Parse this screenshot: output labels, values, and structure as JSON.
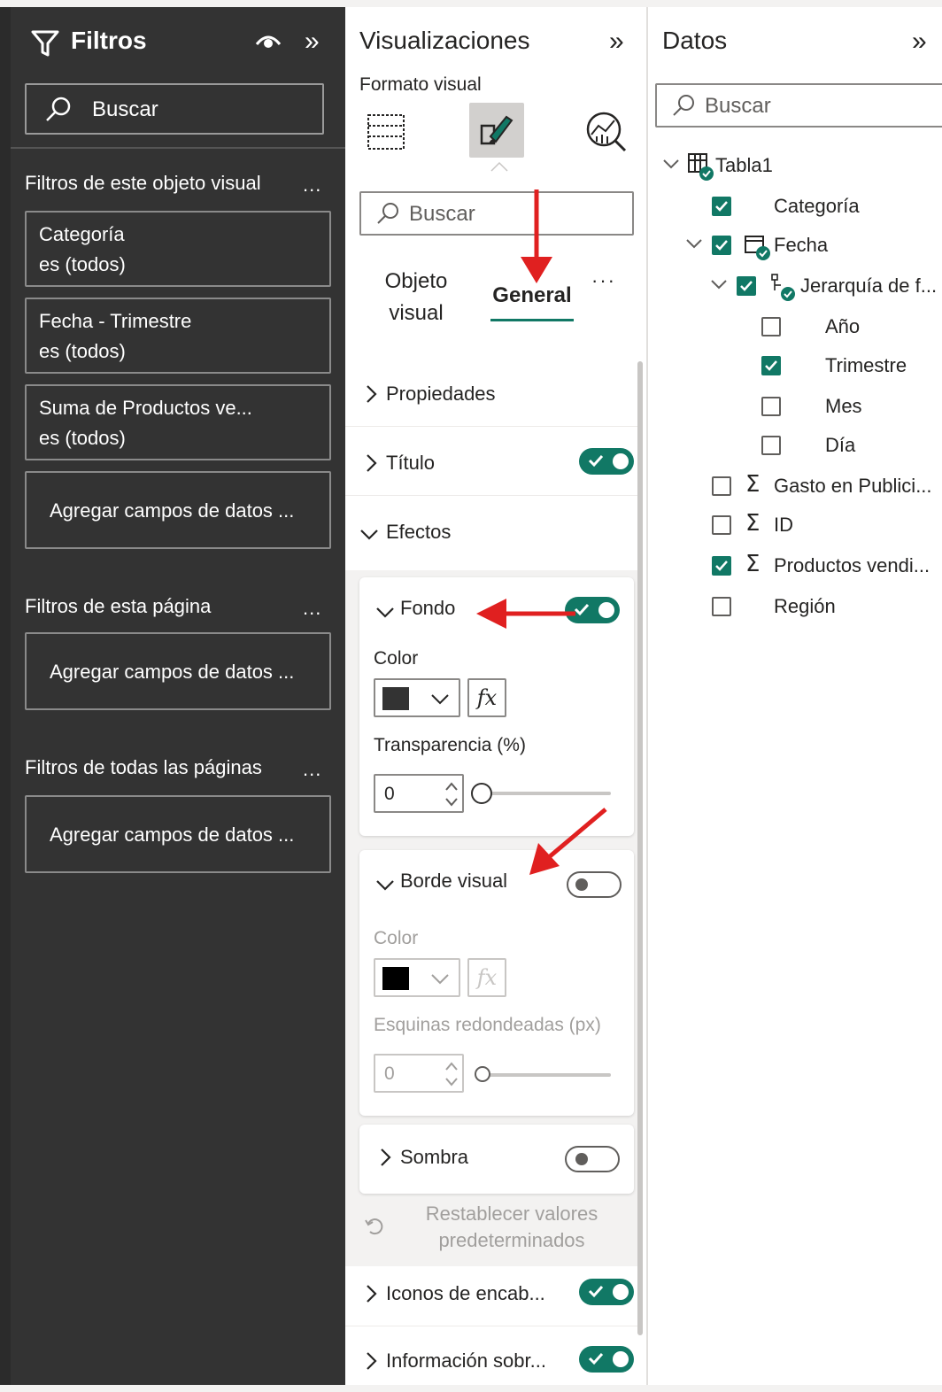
{
  "filters": {
    "title": "Filtros",
    "search_placeholder": "Buscar",
    "sections": {
      "visual": "Filtros de este objeto visual",
      "page": "Filtros de esta página",
      "all": "Filtros de todas las páginas"
    },
    "more": "...",
    "cards": [
      {
        "field": "Categoría",
        "state": "es (todos)"
      },
      {
        "field": "Fecha - Trimestre",
        "state": "es (todos)"
      },
      {
        "field": "Suma de Productos ve...",
        "state": "es (todos)"
      }
    ],
    "add_fields": "Agregar campos de datos ..."
  },
  "visualizations": {
    "title": "Visualizaciones",
    "subtitle": "Formato visual",
    "search_placeholder": "Buscar",
    "tabs": {
      "visual_line1": "Objeto",
      "visual_line2": "visual",
      "general": "General",
      "more": "···"
    },
    "rows": {
      "properties": "Propiedades",
      "title": "Título",
      "effects": "Efectos",
      "header_icons": "Iconos de encab...",
      "tooltip": "Información sobr..."
    },
    "background": {
      "label": "Fondo",
      "color_label": "Color",
      "color_value": "#333333",
      "transparency_label": "Transparencia (%)",
      "transparency_value": "0"
    },
    "border": {
      "label": "Borde visual",
      "color_label": "Color",
      "color_value": "#000000",
      "corners_label": "Esquinas redondeadas (px)",
      "corners_value": "0"
    },
    "shadow": {
      "label": "Sombra"
    },
    "reset_line1": "Restablecer valores",
    "reset_line2": "predeterminados",
    "fx": "fx"
  },
  "data": {
    "title": "Datos",
    "search_placeholder": "Buscar",
    "table": "Tabla1",
    "fields": {
      "category": "Categoría",
      "date": "Fecha",
      "hierarchy": "Jerarquía de f...",
      "year": "Año",
      "quarter": "Trimestre",
      "month": "Mes",
      "day": "Día",
      "ad_spend": "Gasto en Publici...",
      "id": "ID",
      "products_sold": "Productos vendi...",
      "region": "Región"
    }
  },
  "colors": {
    "accent": "#117865",
    "filters_bg": "#333333",
    "annotation": "#e02020"
  }
}
